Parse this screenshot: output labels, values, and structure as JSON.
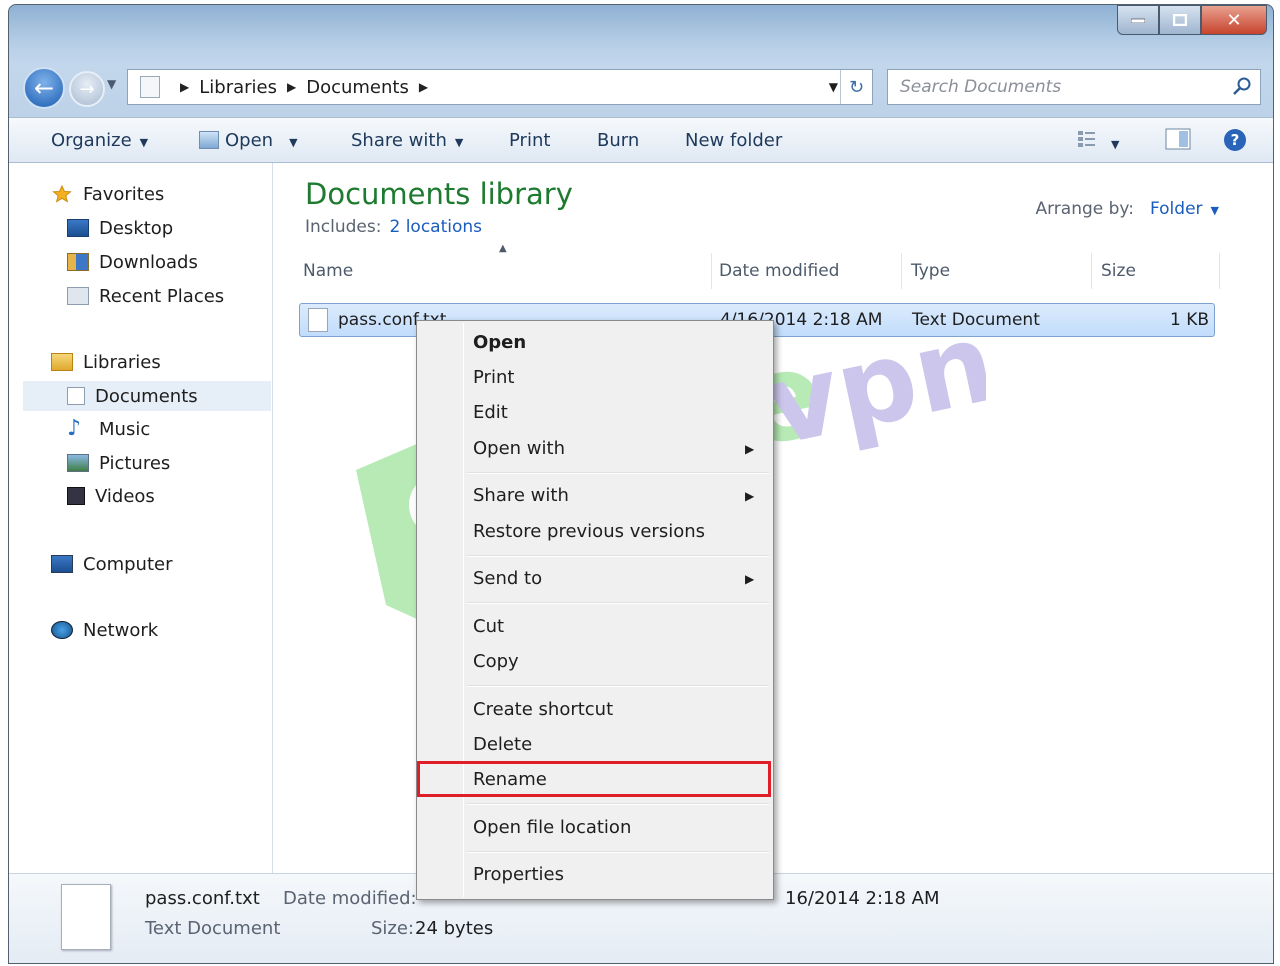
{
  "address_bar": {
    "crumbs": [
      "Libraries",
      "Documents"
    ]
  },
  "search": {
    "placeholder": "Search Documents"
  },
  "toolbar": {
    "organize": "Organize",
    "open": "Open",
    "share_with": "Share with",
    "print": "Print",
    "burn": "Burn",
    "new_folder": "New folder"
  },
  "nav_pane": {
    "favorites": {
      "label": "Favorites",
      "items": [
        "Desktop",
        "Downloads",
        "Recent Places"
      ]
    },
    "libraries": {
      "label": "Libraries",
      "items": [
        "Documents",
        "Music",
        "Pictures",
        "Videos"
      ]
    },
    "computer": "Computer",
    "network": "Network"
  },
  "library": {
    "title": "Documents library",
    "includes_label": "Includes:",
    "includes_link": "2 locations",
    "arrange_label": "Arrange by:",
    "arrange_value": "Folder"
  },
  "columns": [
    "Name",
    "Date modified",
    "Type",
    "Size"
  ],
  "files": [
    {
      "name": "pass.conf.txt",
      "date": "4/16/2014 2:18 AM",
      "type": "Text Document",
      "size": "1 KB"
    }
  ],
  "context_menu": {
    "open": "Open",
    "print": "Print",
    "edit": "Edit",
    "open_with": "Open with",
    "share_with": "Share with",
    "restore": "Restore previous versions",
    "send_to": "Send to",
    "cut": "Cut",
    "copy": "Copy",
    "create_shortcut": "Create shortcut",
    "delete": "Delete",
    "rename": "Rename",
    "open_file_location": "Open file location",
    "properties": "Properties"
  },
  "details_pane": {
    "file_name": "pass.conf.txt",
    "file_type": "Text Document",
    "date_modified_label": "Date modified:",
    "date_created_value": "16/2014 2:18 AM",
    "size_label": "Size:",
    "size_value": "24 bytes"
  },
  "watermark": {
    "text": "purevpn",
    "colors": {
      "green": "#5fd05a",
      "purple": "#8e7fd6"
    }
  },
  "colors": {
    "accent_green": "#1e7a2f",
    "link_blue": "#1a5dbd",
    "highlight_red": "#e01e2a"
  }
}
